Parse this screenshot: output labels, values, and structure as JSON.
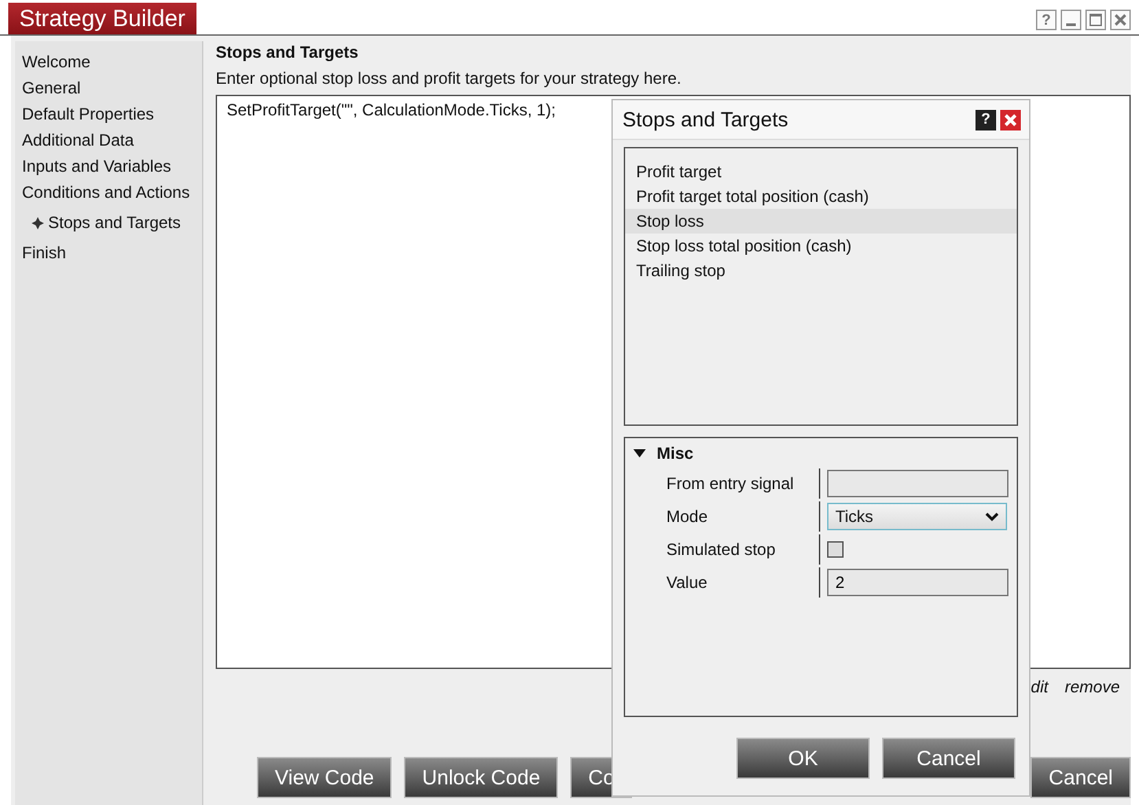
{
  "window": {
    "title": "Strategy Builder",
    "help": "?"
  },
  "sidebar": {
    "items": [
      {
        "label": "Welcome",
        "selected": false
      },
      {
        "label": "General",
        "selected": false
      },
      {
        "label": "Default Properties",
        "selected": false
      },
      {
        "label": "Additional Data",
        "selected": false
      },
      {
        "label": "Inputs and Variables",
        "selected": false
      },
      {
        "label": "Conditions and Actions",
        "selected": false
      },
      {
        "label": "Stops and Targets",
        "selected": true
      },
      {
        "label": "Finish",
        "selected": false
      }
    ]
  },
  "content": {
    "heading": "Stops and Targets",
    "description": "Enter optional stop loss and profit targets for your strategy here.",
    "code": "SetProfitTarget(\"\", CalculationMode.Ticks, 1);",
    "links": [
      "dit",
      "remove"
    ]
  },
  "buttons": [
    "View Code",
    "Unlock Code",
    "Co",
    "Cancel"
  ],
  "dialog": {
    "title": "Stops and Targets",
    "help": "?",
    "items": [
      {
        "label": "Profit target",
        "selected": false
      },
      {
        "label": "Profit target total position (cash)",
        "selected": false
      },
      {
        "label": "Stop loss",
        "selected": true
      },
      {
        "label": "Stop loss total position (cash)",
        "selected": false
      },
      {
        "label": "Trailing stop",
        "selected": false
      }
    ],
    "group": {
      "title": "Misc",
      "expanded": true,
      "properties": [
        {
          "kind": "text",
          "label": "From entry signal"
        },
        {
          "kind": "select",
          "label": "Mode",
          "value": "Ticks"
        },
        {
          "kind": "checkbox",
          "label": "Simulated stop",
          "checked": false
        },
        {
          "kind": "text",
          "label": "Value",
          "value": "2"
        }
      ]
    },
    "buttons": [
      "OK",
      "Cancel"
    ]
  }
}
